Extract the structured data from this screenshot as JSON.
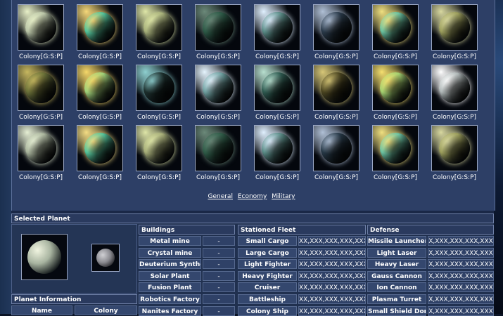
{
  "colonies": [
    {
      "caption": "Colony[G:S:P]",
      "color": "#b9c4a6",
      "glow": "#e8f0c8"
    },
    {
      "caption": "Colony[G:S:P]",
      "color": "#54c49a",
      "glow": "#f5d87a"
    },
    {
      "caption": "Colony[G:S:P]",
      "color": "#a7b07a",
      "glow": "#dfe7a8"
    },
    {
      "caption": "Colony[G:S:P]",
      "color": "#2d5a47",
      "glow": "#6c8a7a"
    },
    {
      "caption": "Colony[G:S:P]",
      "color": "#5a8c87",
      "glow": "#e0f0ff"
    },
    {
      "caption": "Colony[G:S:P]",
      "color": "#2a3a4a",
      "glow": "#b0c0d6"
    },
    {
      "caption": "Colony[G:S:P]",
      "color": "#6bc2a0",
      "glow": "#f0e080"
    },
    {
      "caption": "Colony[G:S:P]",
      "color": "#9c9e5c",
      "glow": "#d8d8a0"
    },
    {
      "caption": "Colony[G:S:P]",
      "color": "#6a7038",
      "glow": "#c7b860"
    },
    {
      "caption": "Colony[G:S:P]",
      "color": "#a0d078",
      "glow": "#f6d86a"
    },
    {
      "caption": "Colony[G:S:P]",
      "color": "#1c2e2c",
      "glow": "#8fd0d0"
    },
    {
      "caption": "Colony[G:S:P]",
      "color": "#6ea0a0",
      "glow": "#e6f5ff"
    },
    {
      "caption": "Colony[G:S:P]",
      "color": "#2e5a50",
      "glow": "#b8e0d0"
    },
    {
      "caption": "Colony[G:S:P]",
      "color": "#4a4420",
      "glow": "#d8c878"
    },
    {
      "caption": "Colony[G:S:P]",
      "color": "#a4d070",
      "glow": "#f6e070"
    },
    {
      "caption": "Colony[G:S:P]",
      "color": "#b0b8b8",
      "glow": "#ffffff"
    },
    {
      "caption": "Colony[G:S:P]",
      "color": "#a9b49c",
      "glow": "#e6efd4"
    },
    {
      "caption": "Colony[G:S:P]",
      "color": "#55c49a",
      "glow": "#f4dd84"
    },
    {
      "caption": "Colony[G:S:P]",
      "color": "#a6ad78",
      "glow": "#dfe6a8"
    },
    {
      "caption": "Colony[G:S:P]",
      "color": "#2f5c48",
      "glow": "#6c8a7a"
    },
    {
      "caption": "Colony[G:S:P]",
      "color": "#5a8c87",
      "glow": "#e0f0ff"
    },
    {
      "caption": "Colony[G:S:P]",
      "color": "#263846",
      "glow": "#b0c0d6"
    },
    {
      "caption": "Colony[G:S:P]",
      "color": "#6cc3a2",
      "glow": "#f0e080"
    },
    {
      "caption": "Colony[G:S:P]",
      "color": "#9c9e5c",
      "glow": "#d8d8a0"
    }
  ],
  "tabs": {
    "general": "General",
    "economy": "Economy",
    "military": "Military"
  },
  "selected_planet": {
    "title": "Selected Planet",
    "image_color": "#a8b4a0",
    "moon_color": "#8a8a90"
  },
  "planet_info": {
    "title": "Planet Information",
    "name_label": "Name",
    "name_value": "Colony"
  },
  "buildings": {
    "title": "Buildings",
    "items": [
      {
        "name": "Metal mine",
        "value": "-"
      },
      {
        "name": "Crystal mine",
        "value": "-"
      },
      {
        "name": "Deuterium Synthesizer",
        "value": "-"
      },
      {
        "name": "Solar Plant",
        "value": "-"
      },
      {
        "name": "Fusion Plant",
        "value": "-"
      },
      {
        "name": "Robotics Factory",
        "value": "-"
      },
      {
        "name": "Nanites Factory",
        "value": "-"
      }
    ]
  },
  "fleet": {
    "title": "Stationed Fleet",
    "items": [
      {
        "name": "Small Cargo",
        "value": "XX,XXX,XXX,XXX,XXX"
      },
      {
        "name": "Large Cargo",
        "value": "XX,XXX,XXX,XXX,XXX"
      },
      {
        "name": "Light Fighter",
        "value": "XX,XXX,XXX,XXX,XXX"
      },
      {
        "name": "Heavy Fighter",
        "value": "XX,XXX,XXX,XXX,XXX"
      },
      {
        "name": "Cruiser",
        "value": "XX,XXX,XXX,XXX,XXX"
      },
      {
        "name": "Battleship",
        "value": "XX,XXX,XXX,XXX,XXX"
      },
      {
        "name": "Colony Ship",
        "value": "XX,XXX,XXX,XXX,XXX"
      }
    ]
  },
  "defense": {
    "title": "Defense",
    "items": [
      {
        "name": "Missile Launcher",
        "value": "X,XXX,XXX,XXX,XXX"
      },
      {
        "name": "Light Laser",
        "value": "X,XXX,XXX,XXX,XXX"
      },
      {
        "name": "Heavy Laser",
        "value": "X,XXX,XXX,XXX,XXX"
      },
      {
        "name": "Gauss Cannon",
        "value": "X,XXX,XXX,XXX,XXX"
      },
      {
        "name": "Ion Cannon",
        "value": "X,XXX,XXX,XXX,XXX"
      },
      {
        "name": "Plasma Turret",
        "value": "X,XXX,XXX,XXX,XXX"
      },
      {
        "name": "Small Shield Dome",
        "value": "X,XXX,XXX,XXX,XXX"
      }
    ]
  }
}
